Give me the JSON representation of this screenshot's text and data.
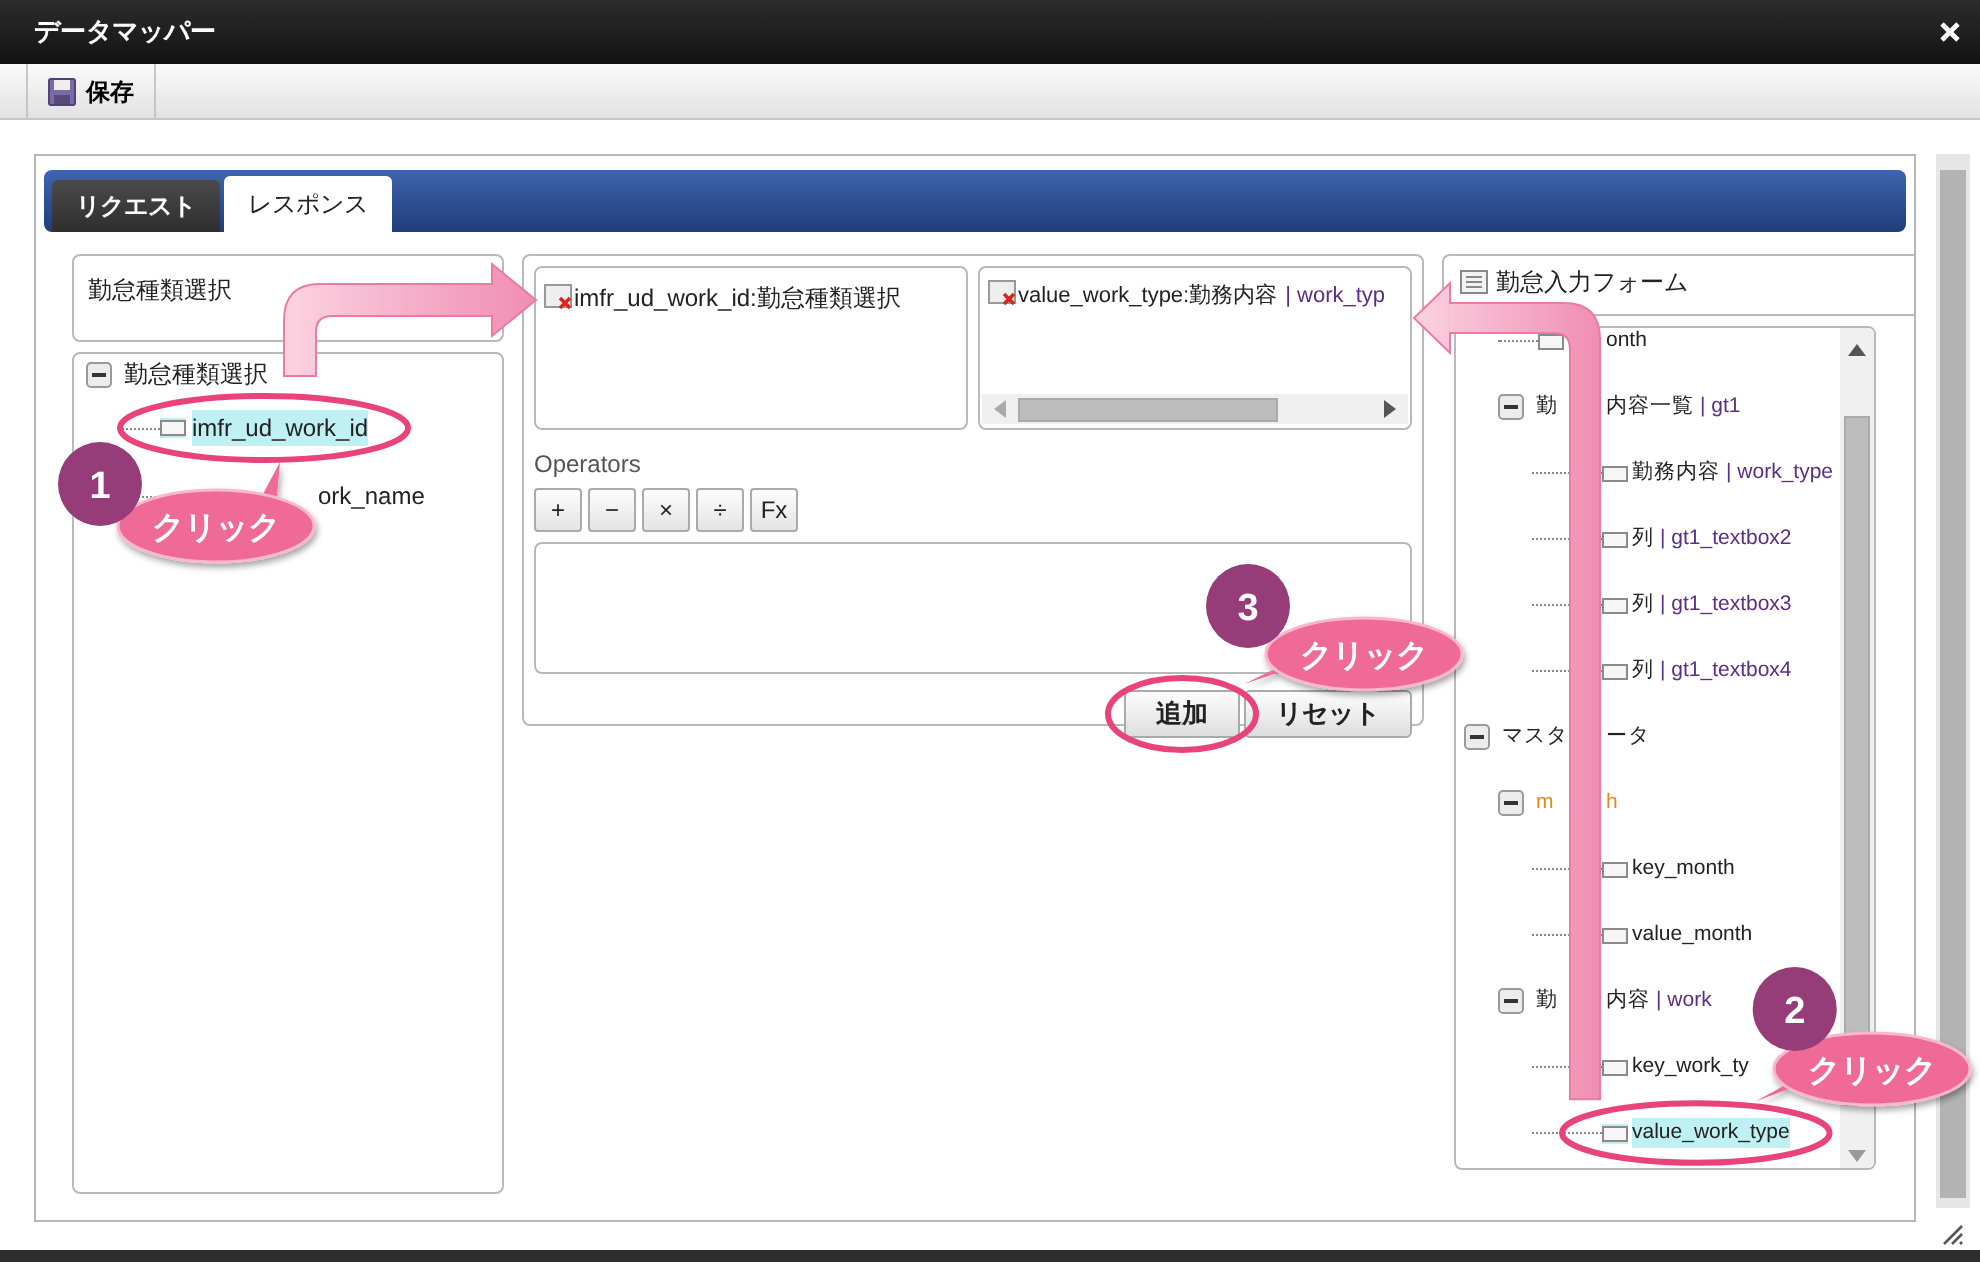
{
  "window": {
    "title": "データマッパー"
  },
  "toolbar": {
    "save_label": "保存"
  },
  "tabs": [
    {
      "label": "リクエスト",
      "selected": false
    },
    {
      "label": "レスポンス",
      "selected": true
    }
  ],
  "left": {
    "header": "勤怠種類選択",
    "tree": [
      {
        "kind": "group",
        "label": "勤怠種類選択",
        "expanded": true,
        "children": [
          {
            "kind": "field",
            "label": "imfr_ud_work_id",
            "selected": true
          },
          {
            "kind": "field",
            "label_after": "ork_name",
            "selected": false
          }
        ]
      }
    ]
  },
  "mapping": {
    "source_item": {
      "label": "imfr_ud_work_id:勤怠種類選択"
    },
    "target_item": {
      "label": "value_work_type:勤務内容",
      "code": "| work_typ"
    },
    "operators_label": "Operators",
    "operators": [
      "+",
      "−",
      "×",
      "÷",
      "Fx"
    ],
    "buttons": [
      "追加",
      "リセット"
    ]
  },
  "right": {
    "header": "勤怠入力フォーム",
    "tree": [
      {
        "children": [
          {
            "kind": "field",
            "label_after": "onth",
            "selected": false
          },
          {
            "kind": "group",
            "expanded": true,
            "label": "勤",
            "label_after": "内容一覧",
            "code": "| gt1",
            "children": [
              {
                "kind": "field",
                "label": "勤務内容",
                "code": "| work_type",
                "selected": false
              },
              {
                "kind": "field",
                "label": "列",
                "code": "| gt1_textbox2",
                "selected": false
              },
              {
                "kind": "field",
                "label": "列",
                "code": "| gt1_textbox3",
                "selected": false
              },
              {
                "kind": "field",
                "label": "列",
                "code": "| gt1_textbox4",
                "selected": false
              }
            ]
          }
        ]
      },
      {
        "kind": "group",
        "expanded": true,
        "label": "マスタ",
        "label_after": "ータ",
        "children": [
          {
            "kind": "source",
            "expanded": true,
            "label": "m",
            "label_after": "h",
            "children": [
              {
                "kind": "field",
                "label": "key_month",
                "selected": false
              },
              {
                "kind": "field",
                "label": "value_month",
                "selected": false
              }
            ]
          },
          {
            "kind": "group",
            "expanded": true,
            "label": "勤",
            "label_after": "内容",
            "code": "| work",
            "children": [
              {
                "kind": "field",
                "label": "key_work_ty",
                "selected": false
              },
              {
                "kind": "field",
                "label": "value_work_type",
                "selected": true
              }
            ]
          }
        ]
      }
    ]
  },
  "annotations": [
    {
      "number": "1",
      "label": "クリック"
    },
    {
      "number": "2",
      "label": "クリック"
    },
    {
      "number": "3",
      "label": "クリック"
    }
  ]
}
